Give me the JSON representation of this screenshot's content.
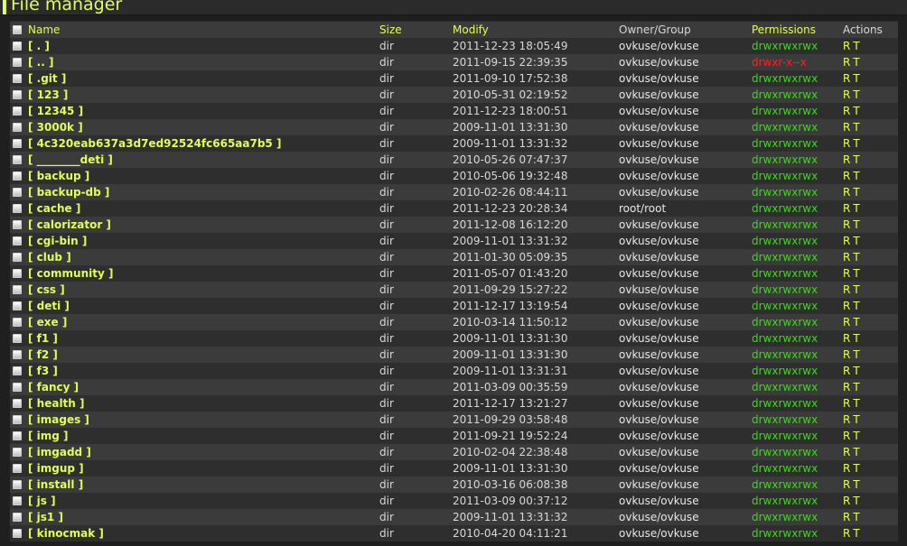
{
  "header": {
    "title": "File manager"
  },
  "colors": {
    "accent": "#dfff5a",
    "permission_ok": "#4bcd2e",
    "permission_restricted": "#ff2020",
    "row_dark": "#2e2e2e",
    "row_light": "#3b3b3b"
  },
  "icons": {
    "select_all": "checkbox-icon",
    "row_select": "checkbox-icon"
  },
  "table": {
    "columns": {
      "name": "Name",
      "size": "Size",
      "modify": "Modify",
      "owner": "Owner/Group",
      "permissions": "Permissions",
      "actions": "Actions"
    },
    "rows": [
      {
        "name": "[ . ]",
        "size": "dir",
        "modify": "2011-12-23 18:05:49",
        "owner": "ovkuse/ovkuse",
        "permissions": "drwxrwxrwx",
        "perm_restricted": false,
        "action_r": "R",
        "action_t": "T"
      },
      {
        "name": "[ .. ]",
        "size": "dir",
        "modify": "2011-09-15 22:39:35",
        "owner": "ovkuse/ovkuse",
        "permissions": "drwxr-x--x",
        "perm_restricted": true,
        "action_r": "R",
        "action_t": "T"
      },
      {
        "name": "[ .git ]",
        "size": "dir",
        "modify": "2011-09-10 17:52:38",
        "owner": "ovkuse/ovkuse",
        "permissions": "drwxrwxrwx",
        "perm_restricted": false,
        "action_r": "R",
        "action_t": "T"
      },
      {
        "name": "[ 123 ]",
        "size": "dir",
        "modify": "2010-05-31 02:19:52",
        "owner": "ovkuse/ovkuse",
        "permissions": "drwxrwxrwx",
        "perm_restricted": false,
        "action_r": "R",
        "action_t": "T"
      },
      {
        "name": "[ 12345 ]",
        "size": "dir",
        "modify": "2011-12-23 18:00:51",
        "owner": "ovkuse/ovkuse",
        "permissions": "drwxrwxrwx",
        "perm_restricted": false,
        "action_r": "R",
        "action_t": "T"
      },
      {
        "name": "[ 3000k ]",
        "size": "dir",
        "modify": "2009-11-01 13:31:30",
        "owner": "ovkuse/ovkuse",
        "permissions": "drwxrwxrwx",
        "perm_restricted": false,
        "action_r": "R",
        "action_t": "T"
      },
      {
        "name": "[ 4c320eab637a3d7ed92524fc665aa7b5 ]",
        "size": "dir",
        "modify": "2009-11-01 13:31:32",
        "owner": "ovkuse/ovkuse",
        "permissions": "drwxrwxrwx",
        "perm_restricted": false,
        "action_r": "R",
        "action_t": "T"
      },
      {
        "name": "[ ________deti ]",
        "size": "dir",
        "modify": "2010-05-26 07:47:37",
        "owner": "ovkuse/ovkuse",
        "permissions": "drwxrwxrwx",
        "perm_restricted": false,
        "action_r": "R",
        "action_t": "T"
      },
      {
        "name": "[ backup ]",
        "size": "dir",
        "modify": "2010-05-06 19:32:48",
        "owner": "ovkuse/ovkuse",
        "permissions": "drwxrwxrwx",
        "perm_restricted": false,
        "action_r": "R",
        "action_t": "T"
      },
      {
        "name": "[ backup-db ]",
        "size": "dir",
        "modify": "2010-02-26 08:44:11",
        "owner": "ovkuse/ovkuse",
        "permissions": "drwxrwxrwx",
        "perm_restricted": false,
        "action_r": "R",
        "action_t": "T"
      },
      {
        "name": "[ cache ]",
        "size": "dir",
        "modify": "2011-12-23 20:28:34",
        "owner": "root/root",
        "permissions": "drwxrwxrwx",
        "perm_restricted": false,
        "action_r": "R",
        "action_t": "T"
      },
      {
        "name": "[ calorizator ]",
        "size": "dir",
        "modify": "2011-12-08 16:12:20",
        "owner": "ovkuse/ovkuse",
        "permissions": "drwxrwxrwx",
        "perm_restricted": false,
        "action_r": "R",
        "action_t": "T"
      },
      {
        "name": "[ cgi-bin ]",
        "size": "dir",
        "modify": "2009-11-01 13:31:32",
        "owner": "ovkuse/ovkuse",
        "permissions": "drwxrwxrwx",
        "perm_restricted": false,
        "action_r": "R",
        "action_t": "T"
      },
      {
        "name": "[ club ]",
        "size": "dir",
        "modify": "2011-01-30 05:09:35",
        "owner": "ovkuse/ovkuse",
        "permissions": "drwxrwxrwx",
        "perm_restricted": false,
        "action_r": "R",
        "action_t": "T"
      },
      {
        "name": "[ community ]",
        "size": "dir",
        "modify": "2011-05-07 01:43:20",
        "owner": "ovkuse/ovkuse",
        "permissions": "drwxrwxrwx",
        "perm_restricted": false,
        "action_r": "R",
        "action_t": "T"
      },
      {
        "name": "[ css ]",
        "size": "dir",
        "modify": "2011-09-29 15:27:22",
        "owner": "ovkuse/ovkuse",
        "permissions": "drwxrwxrwx",
        "perm_restricted": false,
        "action_r": "R",
        "action_t": "T"
      },
      {
        "name": "[ deti ]",
        "size": "dir",
        "modify": "2011-12-17 13:19:54",
        "owner": "ovkuse/ovkuse",
        "permissions": "drwxrwxrwx",
        "perm_restricted": false,
        "action_r": "R",
        "action_t": "T"
      },
      {
        "name": "[ exe ]",
        "size": "dir",
        "modify": "2010-03-14 11:50:12",
        "owner": "ovkuse/ovkuse",
        "permissions": "drwxrwxrwx",
        "perm_restricted": false,
        "action_r": "R",
        "action_t": "T"
      },
      {
        "name": "[ f1 ]",
        "size": "dir",
        "modify": "2009-11-01 13:31:30",
        "owner": "ovkuse/ovkuse",
        "permissions": "drwxrwxrwx",
        "perm_restricted": false,
        "action_r": "R",
        "action_t": "T"
      },
      {
        "name": "[ f2 ]",
        "size": "dir",
        "modify": "2009-11-01 13:31:30",
        "owner": "ovkuse/ovkuse",
        "permissions": "drwxrwxrwx",
        "perm_restricted": false,
        "action_r": "R",
        "action_t": "T"
      },
      {
        "name": "[ f3 ]",
        "size": "dir",
        "modify": "2009-11-01 13:31:31",
        "owner": "ovkuse/ovkuse",
        "permissions": "drwxrwxrwx",
        "perm_restricted": false,
        "action_r": "R",
        "action_t": "T"
      },
      {
        "name": "[ fancy ]",
        "size": "dir",
        "modify": "2011-03-09 00:35:59",
        "owner": "ovkuse/ovkuse",
        "permissions": "drwxrwxrwx",
        "perm_restricted": false,
        "action_r": "R",
        "action_t": "T"
      },
      {
        "name": "[ health ]",
        "size": "dir",
        "modify": "2011-12-17 13:21:27",
        "owner": "ovkuse/ovkuse",
        "permissions": "drwxrwxrwx",
        "perm_restricted": false,
        "action_r": "R",
        "action_t": "T"
      },
      {
        "name": "[ images ]",
        "size": "dir",
        "modify": "2011-09-29 03:58:48",
        "owner": "ovkuse/ovkuse",
        "permissions": "drwxrwxrwx",
        "perm_restricted": false,
        "action_r": "R",
        "action_t": "T"
      },
      {
        "name": "[ img ]",
        "size": "dir",
        "modify": "2011-09-21 19:52:24",
        "owner": "ovkuse/ovkuse",
        "permissions": "drwxrwxrwx",
        "perm_restricted": false,
        "action_r": "R",
        "action_t": "T"
      },
      {
        "name": "[ imgadd ]",
        "size": "dir",
        "modify": "2010-02-04 22:38:48",
        "owner": "ovkuse/ovkuse",
        "permissions": "drwxrwxrwx",
        "perm_restricted": false,
        "action_r": "R",
        "action_t": "T"
      },
      {
        "name": "[ imgup ]",
        "size": "dir",
        "modify": "2009-11-01 13:31:30",
        "owner": "ovkuse/ovkuse",
        "permissions": "drwxrwxrwx",
        "perm_restricted": false,
        "action_r": "R",
        "action_t": "T"
      },
      {
        "name": "[ install ]",
        "size": "dir",
        "modify": "2010-03-16 06:08:38",
        "owner": "ovkuse/ovkuse",
        "permissions": "drwxrwxrwx",
        "perm_restricted": false,
        "action_r": "R",
        "action_t": "T"
      },
      {
        "name": "[ js ]",
        "size": "dir",
        "modify": "2011-03-09 00:37:12",
        "owner": "ovkuse/ovkuse",
        "permissions": "drwxrwxrwx",
        "perm_restricted": false,
        "action_r": "R",
        "action_t": "T"
      },
      {
        "name": "[ js1 ]",
        "size": "dir",
        "modify": "2009-11-01 13:31:32",
        "owner": "ovkuse/ovkuse",
        "permissions": "drwxrwxrwx",
        "perm_restricted": false,
        "action_r": "R",
        "action_t": "T"
      },
      {
        "name": "[ kinocmak ]",
        "size": "dir",
        "modify": "2010-04-20 04:11:21",
        "owner": "ovkuse/ovkuse",
        "permissions": "drwxrwxrwx",
        "perm_restricted": false,
        "action_r": "R",
        "action_t": "T"
      }
    ]
  }
}
